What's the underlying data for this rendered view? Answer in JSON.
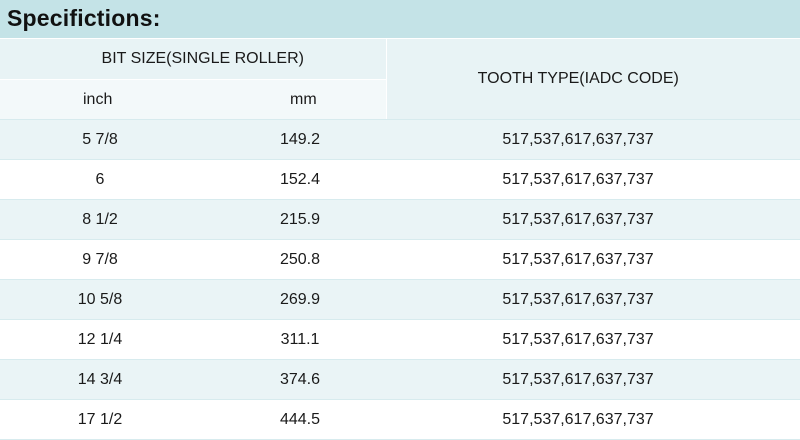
{
  "title": "Specifictions:",
  "header": {
    "bit_size": "BIT SIZE(SINGLE ROLLER)",
    "tooth_type": "TOOTH TYPE(IADC CODE)",
    "inch": "inch",
    "mm": "mm"
  },
  "rows": [
    {
      "inch": "5 7/8",
      "mm": "149.2",
      "tooth": "517,537,617,637,737"
    },
    {
      "inch": "6",
      "mm": "152.4",
      "tooth": "517,537,617,637,737"
    },
    {
      "inch": "8 1/2",
      "mm": "215.9",
      "tooth": "517,537,617,637,737"
    },
    {
      "inch": "9 7/8",
      "mm": "250.8",
      "tooth": "517,537,617,637,737"
    },
    {
      "inch": "10 5/8",
      "mm": "269.9",
      "tooth": "517,537,617,637,737"
    },
    {
      "inch": "12 1/4",
      "mm": "311.1",
      "tooth": "517,537,617,637,737"
    },
    {
      "inch": "14 3/4",
      "mm": "374.6",
      "tooth": "517,537,617,637,737"
    },
    {
      "inch": "17 1/2",
      "mm": "444.5",
      "tooth": "517,537,617,637,737"
    }
  ],
  "colors": {
    "title_bar": "#c4e3e7",
    "header_bg": "#e8f3f5",
    "stripe_bg": "#eaf4f6"
  }
}
